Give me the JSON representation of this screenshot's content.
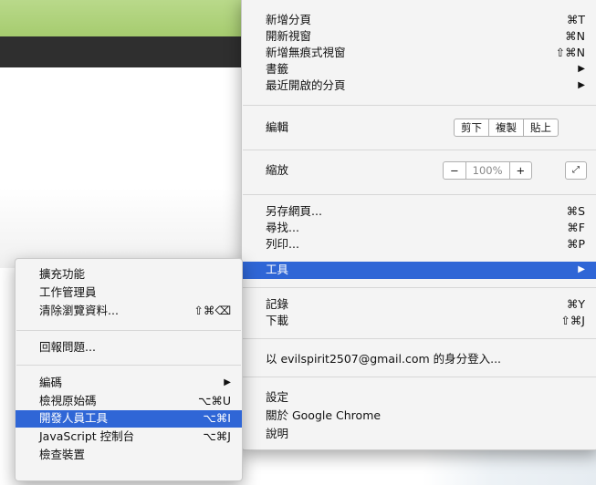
{
  "main_menu": {
    "new_tab": {
      "label": "新增分頁",
      "shortcut": "⌘T"
    },
    "new_window": {
      "label": "開新視窗",
      "shortcut": "⌘N"
    },
    "incognito": {
      "label": "新增無痕式視窗",
      "shortcut": "⇧⌘N"
    },
    "bookmarks": {
      "label": "書籤"
    },
    "recent_tabs": {
      "label": "最近開啟的分頁"
    },
    "edit": {
      "label": "編輯",
      "cut": "剪下",
      "copy": "複製",
      "paste": "貼上"
    },
    "zoom": {
      "label": "縮放",
      "minus": "−",
      "value": "100%",
      "plus": "+"
    },
    "save_page": {
      "label": "另存網頁...",
      "shortcut": "⌘S"
    },
    "find": {
      "label": "尋找...",
      "shortcut": "⌘F"
    },
    "print": {
      "label": "列印...",
      "shortcut": "⌘P"
    },
    "tools": {
      "label": "工具"
    },
    "history": {
      "label": "記錄",
      "shortcut": "⌘Y"
    },
    "downloads": {
      "label": "下載",
      "shortcut": "⇧⌘J"
    },
    "signin": {
      "label": "以 evilspirit2507@gmail.com 的身分登入..."
    },
    "settings": {
      "label": "設定"
    },
    "about": {
      "label": "關於 Google Chrome"
    },
    "help": {
      "label": "說明"
    }
  },
  "tools_submenu": {
    "extensions": {
      "label": "擴充功能"
    },
    "task_manager": {
      "label": "工作管理員"
    },
    "clear_data": {
      "label": "清除瀏覽資料...",
      "shortcut": "⇧⌘⌫"
    },
    "report_issue": {
      "label": "回報問題..."
    },
    "encoding": {
      "label": "編碼"
    },
    "view_source": {
      "label": "檢視原始碼",
      "shortcut": "⌥⌘U"
    },
    "dev_tools": {
      "label": "開發人員工具",
      "shortcut": "⌥⌘I"
    },
    "js_console": {
      "label": "JavaScript 控制台",
      "shortcut": "⌥⌘J"
    },
    "inspect": {
      "label": "檢查裝置"
    }
  },
  "colors": {
    "highlight": "#2f66d6",
    "menu_bg": "#f4f4f4",
    "toolbar_dark": "#2f2f2f",
    "green_band": "#b0d47c"
  },
  "icons": {
    "submenu_arrow": "▶",
    "fullscreen": "fullscreen-icon"
  }
}
